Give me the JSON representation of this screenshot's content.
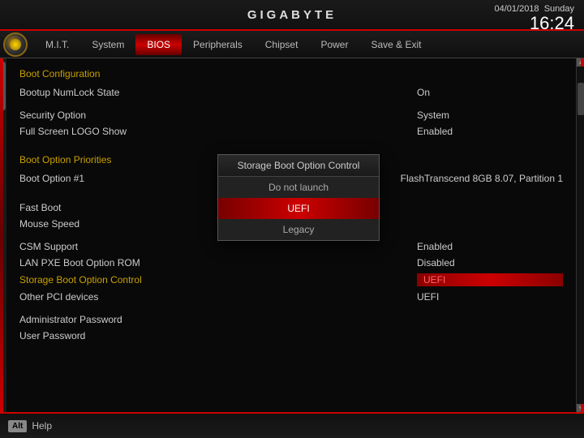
{
  "header": {
    "logo": "GIGABYTE",
    "date": "04/01/2018",
    "day": "Sunday",
    "time": "16:24"
  },
  "navbar": {
    "items": [
      {
        "id": "mit",
        "label": "M.I.T.",
        "active": false
      },
      {
        "id": "system",
        "label": "System",
        "active": false
      },
      {
        "id": "bios",
        "label": "BIOS",
        "active": true
      },
      {
        "id": "peripherals",
        "label": "Peripherals",
        "active": false
      },
      {
        "id": "chipset",
        "label": "Chipset",
        "active": false
      },
      {
        "id": "power",
        "label": "Power",
        "active": false
      },
      {
        "id": "save-exit",
        "label": "Save & Exit",
        "active": false
      }
    ]
  },
  "sections": {
    "boot_configuration": {
      "title": "Boot Configuration",
      "settings": [
        {
          "label": "Bootup NumLock State",
          "value": "On"
        },
        {
          "label": "",
          "value": ""
        },
        {
          "label": "Security Option",
          "value": "System"
        },
        {
          "label": "Full Screen LOGO Show",
          "value": "Enabled"
        }
      ]
    },
    "boot_option_priorities": {
      "title": "Boot Option Priorities",
      "settings": [
        {
          "label": "Boot Option #1",
          "value": "FlashTranscend 8GB 8.07, Partition 1"
        }
      ]
    },
    "other_settings": {
      "settings": [
        {
          "label": "Fast Boot",
          "value": ""
        },
        {
          "label": "Mouse Speed",
          "value": ""
        }
      ]
    },
    "csm": {
      "settings": [
        {
          "label": "CSM Support",
          "value": "Enabled"
        },
        {
          "label": "LAN PXE Boot Option ROM",
          "value": "Disabled"
        },
        {
          "label": "Storage Boot Option Control",
          "value": "UEFI",
          "highlighted": true
        },
        {
          "label": "Other PCI devices",
          "value": "UEFI"
        }
      ]
    },
    "passwords": {
      "settings": [
        {
          "label": "Administrator Password",
          "value": ""
        },
        {
          "label": "User Password",
          "value": ""
        }
      ]
    }
  },
  "dropdown": {
    "title": "Storage Boot Option Control",
    "options": [
      {
        "label": "Do not launch",
        "selected": false
      },
      {
        "label": "UEFI",
        "selected": true
      },
      {
        "label": "Legacy",
        "selected": false
      }
    ]
  },
  "bottom": {
    "alt_key": "Alt",
    "help_label": "Help"
  }
}
